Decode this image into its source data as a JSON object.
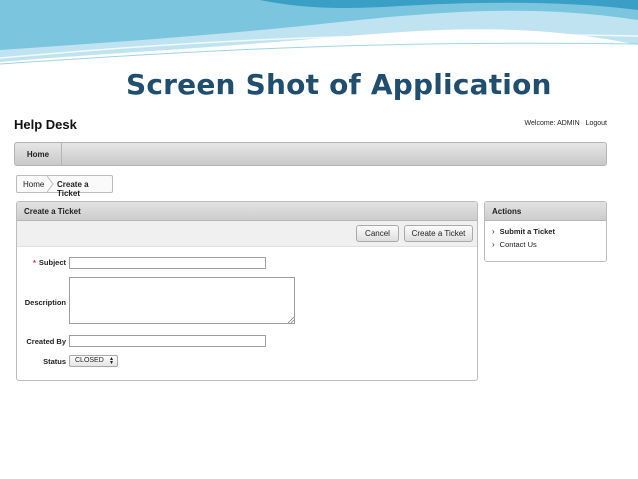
{
  "slide": {
    "title": "Screen Shot of Application",
    "colors": {
      "title": "#1f4e6e",
      "wave_light": "#bfe3f0",
      "wave_dark": "#3a9fc4"
    }
  },
  "app": {
    "title": "Help Desk",
    "user": {
      "welcome": "Welcome: ADMIN",
      "logout": "Logout"
    },
    "nav": {
      "tabs": [
        {
          "label": "Home"
        }
      ]
    },
    "breadcrumb": {
      "home": "Home",
      "current": "Create a Ticket"
    },
    "form": {
      "title": "Create a Ticket",
      "buttons": {
        "cancel": "Cancel",
        "create": "Create a Ticket"
      },
      "fields": {
        "subject": {
          "label": "Subject",
          "required_marker": "*",
          "value": ""
        },
        "description": {
          "label": "Description",
          "value": ""
        },
        "created_by": {
          "label": "Created By",
          "value": ""
        },
        "status": {
          "label": "Status",
          "value": "CLOSED"
        }
      }
    },
    "actions": {
      "title": "Actions",
      "items": [
        {
          "label": "Submit a Ticket",
          "icon": "chevron-right-icon",
          "active": true
        },
        {
          "label": "Contact Us",
          "icon": "chevron-right-icon",
          "active": false
        }
      ]
    }
  }
}
